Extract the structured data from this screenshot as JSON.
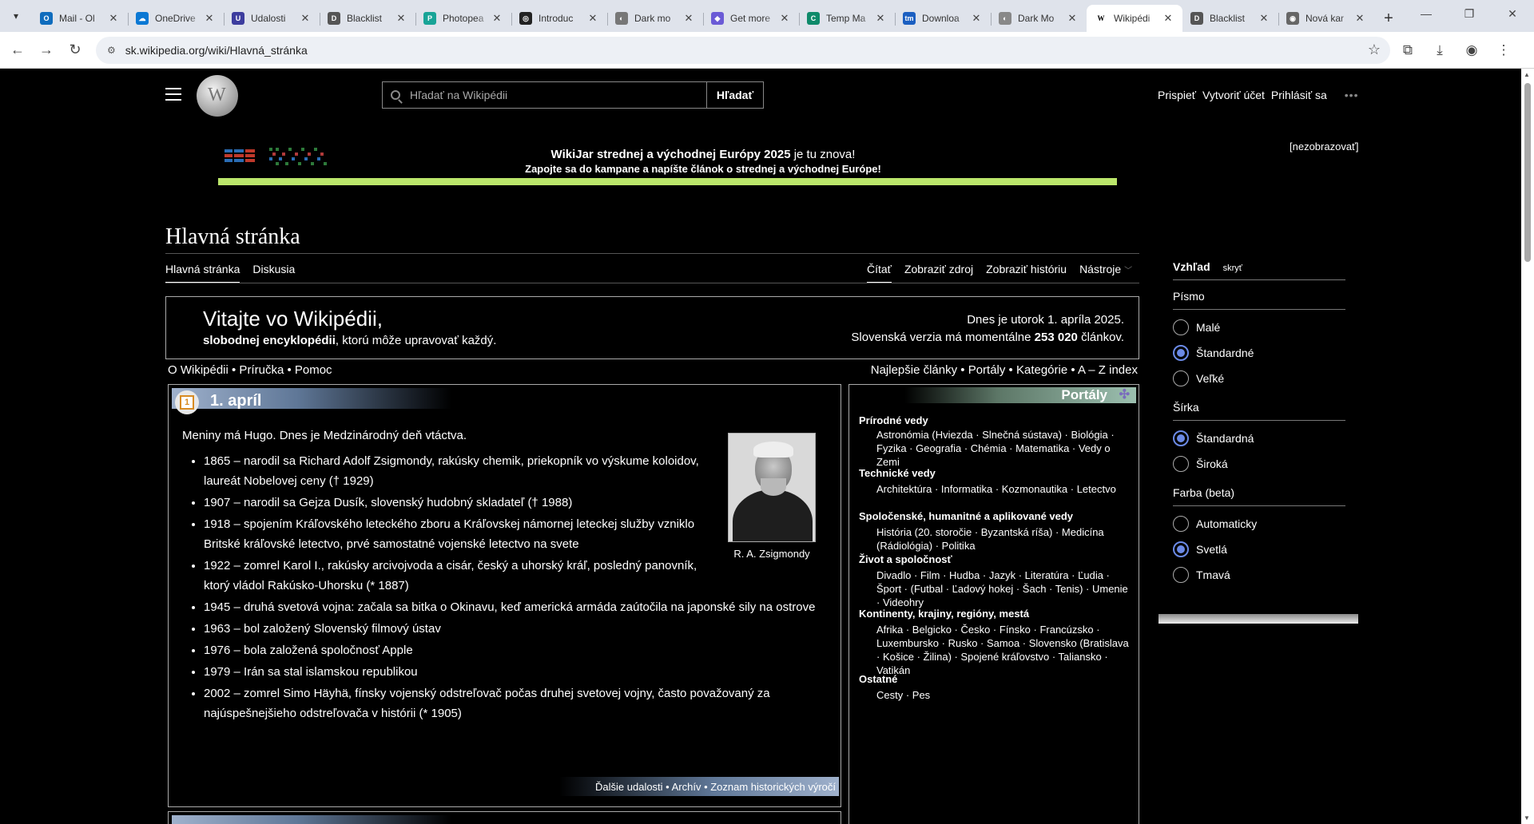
{
  "browser": {
    "tabs": [
      {
        "title": "Mail - Ol",
        "fav": "O",
        "fav_color": "#0f6cbd"
      },
      {
        "title": "OneDrive",
        "fav": "☁",
        "fav_color": "#0a78d4"
      },
      {
        "title": "Udalosti",
        "fav": "U",
        "fav_color": "#3d3d9e"
      },
      {
        "title": "Blacklist",
        "fav": "D",
        "fav_color": "#555555"
      },
      {
        "title": "Photopea",
        "fav": "P",
        "fav_color": "#18a497"
      },
      {
        "title": "Introduc",
        "fav": "◎",
        "fav_color": "#222222"
      },
      {
        "title": "Dark mo",
        "fav": "◐",
        "fav_color": "#777777"
      },
      {
        "title": "Get more",
        "fav": "◆",
        "fav_color": "#6b5bd6"
      },
      {
        "title": "Temp Ma",
        "fav": "C",
        "fav_color": "#0f8a6a"
      },
      {
        "title": "Downloa",
        "fav": "tm",
        "fav_color": "#1b5fc1"
      },
      {
        "title": "Dark Mo",
        "fav": "◐",
        "fav_color": "#888888"
      },
      {
        "title": "Wikipédi",
        "fav": "W",
        "fav_color": "#ffffff",
        "active": true
      },
      {
        "title": "Blacklist",
        "fav": "D",
        "fav_color": "#555555"
      },
      {
        "title": "Nová kar",
        "fav": "◉",
        "fav_color": "#666666"
      }
    ],
    "url": "sk.wikipedia.org/wiki/Hlavná_stránka"
  },
  "header": {
    "search_placeholder": "Hľadať na Wikipédii",
    "search_button": "Hľadať",
    "user_links": [
      "Prispieť",
      "Vytvoriť účet",
      "Prihlásiť sa"
    ],
    "more": "•••"
  },
  "banner": {
    "line1_bold": "WikiJar strednej a východnej Európy 2025",
    "line1_rest": " je tu znova!",
    "line2": "Zapojte sa do kampane a napíšte článok o strednej a východnej Európe!",
    "hide": "[nezobrazovať]",
    "bar_color": "#bbe66b"
  },
  "article": {
    "title": "Hlavná stránka",
    "tabs_left": [
      "Hlavná stránka",
      "Diskusia"
    ],
    "tabs_right": [
      "Čítať",
      "Zobraziť zdroj",
      "Zobraziť históriu",
      "Nástroje"
    ]
  },
  "welcome": {
    "title": "Vitajte vo Wikipédii,",
    "sub_bold": "slobodnej encyklopédii",
    "sub_rest": ", ktorú môže upravovať každý.",
    "date": "Dnes je utorok 1. apríla 2025.",
    "count_pre": "Slovenská verzia má momentálne ",
    "count_bold": "253 020",
    "count_post": " článkov."
  },
  "links": {
    "left": "O Wikipédii • Príručka • Pomoc",
    "right": "Najlepšie články • Portály • Kategórie • A – Z index"
  },
  "april": {
    "icon": "1",
    "title": "1. apríl",
    "intro": "Meniny má Hugo. Dnes je Medzinárodný deň vtáctva.",
    "caption": "R. A. Zsigmondy",
    "events": [
      "1865 – narodil sa Richard Adolf Zsigmondy, rakúsky chemik, priekopník vo výskume koloidov, laureát Nobelovej ceny († 1929)",
      "1907 – narodil sa Gejza Dusík, slovenský hudobný skladateľ († 1988)",
      "1918 – spojením Kráľovského leteckého zboru a Kráľovskej námornej leteckej služby vzniklo Britské kráľovské letectvo, prvé samostatné vojenské letectvo na svete",
      "1922 – zomrel Karol I., rakúsky arcivojvoda a cisár, český a uhorský kráľ, posledný panovník, ktorý vládol Rakúsko-Uhorsku (* 1887)",
      "1945 – druhá svetová vojna: začala sa bitka o Okinavu, keď americká armáda zaútočila na japonské sily na ostrove",
      "1963 – bol založený Slovenský filmový ústav",
      "1976 – bola založená spoločnosť Apple",
      "1979 – Irán sa stal islamskou republikou",
      "2002 – zomrel Simo Häyhä, fínsky vojenský odstreľovač počas druhej svetovej vojny, často považovaný za najúspešnejšieho odstreľovača v histórii (* 1905)"
    ],
    "footer": "Ďalšie udalosti • Archív • Zoznam historických výročí"
  },
  "portals": {
    "title": "Portály",
    "sections": [
      {
        "cat": "Prírodné vedy",
        "items": "Astronómia (Hviezda · Slnečná sústava) · Biológia · Fyzika · Geografia · Chémia · Matematika · Vedy o Zemi"
      },
      {
        "cat": "Technické vedy",
        "items": "Architektúra · Informatika · Kozmonautika · Letectvo"
      },
      {
        "cat": "Spoločenské, humanitné a aplikované vedy",
        "items": "História (20. storočie · Byzantská ríša) · Medicína (Rádiológia) · Politika"
      },
      {
        "cat": "Život a spoločnosť",
        "items": "Divadlo · Film · Hudba · Jazyk · Literatúra · Ľudia · Šport · (Futbal · Ľadový hokej · Šach · Tenis) · Umenie · Videohry"
      },
      {
        "cat": "Kontinenty, krajiny, regióny, mestá",
        "items": "Afrika · Belgicko · Česko · Fínsko · Francúzsko · Luxembursko · Rusko · Samoa · Slovensko (Bratislava · Košice · Žilina) · Spojené kráľovstvo · Taliansko · Vatikán"
      },
      {
        "cat": "Ostatné",
        "items": "Cesty · Pes"
      }
    ]
  },
  "appearance": {
    "title": "Vzhľad",
    "hide": "skryť",
    "font_label": "Písmo",
    "font_options": [
      "Malé",
      "Štandardné",
      "Veľké"
    ],
    "font_selected": 1,
    "width_label": "Šírka",
    "width_options": [
      "Štandardná",
      "Široká"
    ],
    "width_selected": 0,
    "color_label": "Farba (beta)",
    "color_options": [
      "Automaticky",
      "Svetlá",
      "Tmavá"
    ],
    "color_selected": 1,
    "accent": "#6b8ae6"
  }
}
